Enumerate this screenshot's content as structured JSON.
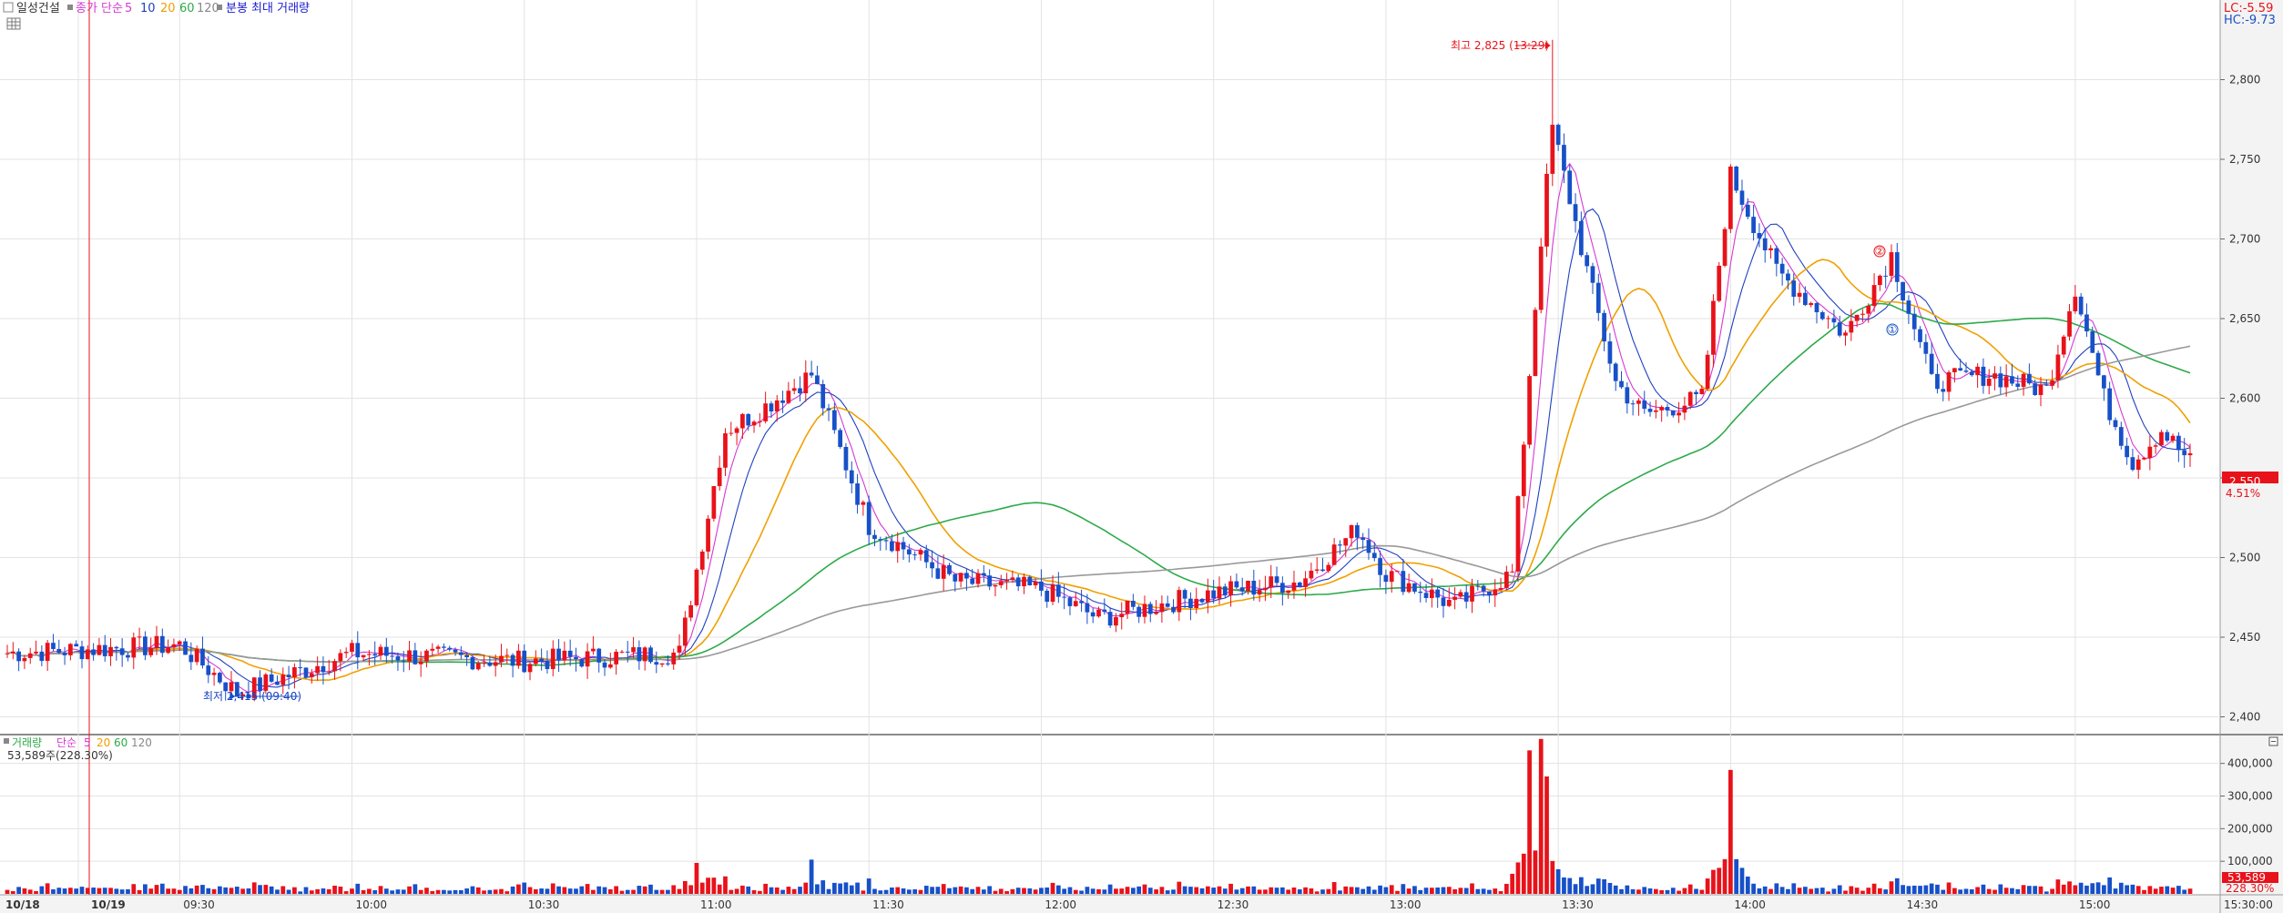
{
  "header": {
    "stock_name": "일성건설",
    "price_legend_prefix": "종가 단순",
    "ma_periods": [
      "5",
      "10",
      "20",
      "60",
      "120"
    ],
    "volume_label": "분봉 최대 거래량",
    "lc_text": "LC:-5.59",
    "hc_text": "HC:-9.73"
  },
  "volume_header": {
    "label": "거래량",
    "legend_prefix": "단순",
    "ma_periods": [
      "5",
      "20",
      "60",
      "120"
    ],
    "current_text": "53,589주(228.30%)"
  },
  "colors": {
    "up": "#e8121a",
    "down": "#1750c8",
    "ma5": "#d43ad4",
    "ma10": "#2040c0",
    "ma20": "#f0a000",
    "ma60": "#2caa4a",
    "ma120": "#999999",
    "grid": "#e3e3e3",
    "axis_bg": "#f2f2f2"
  },
  "annotations": {
    "high_text": "최고 2,825 (13:29)",
    "low_text": "최저 2,415 (09:40)",
    "marker_one": "①",
    "marker_two": "②",
    "current_price": "2,550",
    "current_change": "4.51%",
    "current_volume": "53,589",
    "current_vol_pct": "228.30%"
  },
  "chart_data": [
    {
      "type": "candlestick",
      "title": "일성건설",
      "interval": "1 minute",
      "ylim": [
        2390,
        2850
      ],
      "y_ticks": [
        "2,400",
        "2,450",
        "2,500",
        "2,550",
        "2,600",
        "2,650",
        "2,700",
        "2,750",
        "2,800"
      ],
      "x_ticks": [
        "10/18",
        "10/19",
        "09:30",
        "10:00",
        "10:30",
        "11:00",
        "11:30",
        "12:00",
        "12:30",
        "13:00",
        "13:30",
        "14:00",
        "14:30",
        "15:00",
        "15:30:00"
      ],
      "keypoints": [
        {
          "time": "09:00",
          "price": 2440
        },
        {
          "time": "09:30",
          "price": 2445
        },
        {
          "time": "09:40",
          "price": 2415
        },
        {
          "time": "10:00",
          "price": 2440
        },
        {
          "time": "10:30",
          "price": 2435
        },
        {
          "time": "10:57",
          "price": 2440
        },
        {
          "time": "11:05",
          "price": 2580
        },
        {
          "time": "11:10",
          "price": 2590
        },
        {
          "time": "11:20",
          "price": 2615
        },
        {
          "time": "11:30",
          "price": 2520
        },
        {
          "time": "11:45",
          "price": 2485
        },
        {
          "time": "12:00",
          "price": 2480
        },
        {
          "time": "12:10",
          "price": 2462
        },
        {
          "time": "12:30",
          "price": 2478
        },
        {
          "time": "12:45",
          "price": 2485
        },
        {
          "time": "12:55",
          "price": 2518
        },
        {
          "time": "13:00",
          "price": 2490
        },
        {
          "time": "13:12",
          "price": 2470
        },
        {
          "time": "13:22",
          "price": 2490
        },
        {
          "time": "13:27",
          "price": 2700
        },
        {
          "time": "13:29",
          "price": 2770
        },
        {
          "time": "13:35",
          "price": 2680
        },
        {
          "time": "13:40",
          "price": 2610
        },
        {
          "time": "13:45",
          "price": 2590
        },
        {
          "time": "13:55",
          "price": 2600
        },
        {
          "time": "14:00",
          "price": 2740
        },
        {
          "time": "14:08",
          "price": 2680
        },
        {
          "time": "14:20",
          "price": 2640
        },
        {
          "time": "14:28",
          "price": 2690
        },
        {
          "time": "14:35",
          "price": 2610
        },
        {
          "time": "14:45",
          "price": 2615
        },
        {
          "time": "14:55",
          "price": 2605
        },
        {
          "time": "15:00",
          "price": 2670
        },
        {
          "time": "15:05",
          "price": 2600
        },
        {
          "time": "15:10",
          "price": 2560
        },
        {
          "time": "15:15",
          "price": 2580
        },
        {
          "time": "15:20",
          "price": 2560
        }
      ],
      "high": {
        "price": 2825,
        "time": "13:29"
      },
      "low": {
        "price": 2415,
        "time": "09:40"
      },
      "last_price": 2550,
      "change_pct": 4.51,
      "moving_averages": [
        "5",
        "10",
        "20",
        "60",
        "120"
      ]
    },
    {
      "type": "bar",
      "title": "거래량",
      "ylim": [
        0,
        480000
      ],
      "y_ticks": [
        "100,000",
        "200,000",
        "300,000",
        "400,000"
      ],
      "last_volume": 53589,
      "last_volume_pct": 228.3,
      "spikes": [
        {
          "time": "11:00",
          "volume": 95000
        },
        {
          "time": "11:20",
          "volume": 105000
        },
        {
          "time": "13:25",
          "volume": 440000
        },
        {
          "time": "13:27",
          "volume": 475000
        },
        {
          "time": "13:28",
          "volume": 360000
        },
        {
          "time": "14:00",
          "volume": 380000
        }
      ]
    }
  ]
}
